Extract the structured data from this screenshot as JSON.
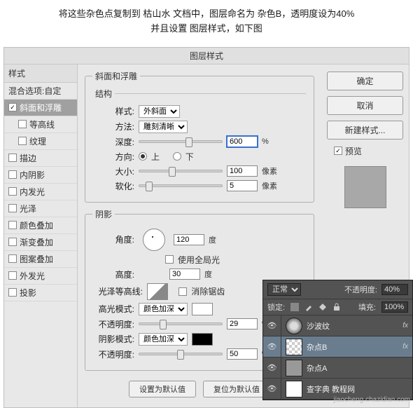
{
  "instruction": {
    "line1": "将这些杂色点复制到 枯山水 文档中，图层命名为 杂色B，透明度设为40%",
    "line2": "并且设置 图层样式，如下图"
  },
  "dialog": {
    "title": "图层样式",
    "styles_header": "样式",
    "blend_opts": "混合选项:自定",
    "style_items": [
      {
        "label": "斜面和浮雕",
        "checked": true,
        "selected": true
      },
      {
        "label": "等高线",
        "checked": false,
        "indent": true
      },
      {
        "label": "纹理",
        "checked": false,
        "indent": true
      },
      {
        "label": "描边",
        "checked": false
      },
      {
        "label": "内阴影",
        "checked": false
      },
      {
        "label": "内发光",
        "checked": false
      },
      {
        "label": "光泽",
        "checked": false
      },
      {
        "label": "颜色叠加",
        "checked": false
      },
      {
        "label": "渐变叠加",
        "checked": false
      },
      {
        "label": "图案叠加",
        "checked": false
      },
      {
        "label": "外发光",
        "checked": false
      },
      {
        "label": "投影",
        "checked": false
      }
    ],
    "bevel": {
      "group": "斜面和浮雕",
      "structure": "结构",
      "style_lab": "样式:",
      "style_val": "外斜面",
      "tech_lab": "方法:",
      "tech_val": "雕刻清晰",
      "depth_lab": "深度:",
      "depth_val": "600",
      "depth_unit": "%",
      "dir_lab": "方向:",
      "dir_up": "上",
      "dir_down": "下",
      "size_lab": "大小:",
      "size_val": "100",
      "size_unit": "像素",
      "soften_lab": "软化:",
      "soften_val": "5",
      "soften_unit": "像素"
    },
    "shade": {
      "group": "阴影",
      "angle_lab": "角度:",
      "angle_val": "120",
      "angle_unit": "度",
      "global_lab": "使用全局光",
      "alt_lab": "高度:",
      "alt_val": "30",
      "alt_unit": "度",
      "gloss_lab": "光泽等高线:",
      "antialias": "消除锯齿",
      "hl_mode_lab": "高光模式:",
      "hl_mode_val": "颜色加深",
      "hl_op_lab": "不透明度:",
      "hl_op_val": "29",
      "hl_op_unit": "%",
      "sh_mode_lab": "阴影模式:",
      "sh_mode_val": "颜色加深",
      "sh_op_lab": "不透明度:",
      "sh_op_val": "50",
      "sh_op_unit": "%"
    },
    "set_default": "设置为默认值",
    "reset_default": "复位为默认值",
    "ok": "确定",
    "cancel": "取消",
    "new_style": "新建样式...",
    "preview": "预览"
  },
  "layers": {
    "blend": "正常",
    "opacity_lab": "不透明度:",
    "opacity_val": "40%",
    "lock_lab": "锁定:",
    "fill_lab": "填充:",
    "fill_val": "100%",
    "rows": [
      {
        "name": "沙波纹",
        "fx": "fx"
      },
      {
        "name": "杂点B",
        "fx": "fx",
        "sel": true
      },
      {
        "name": "杂点A"
      },
      {
        "name": "查字典 教程网"
      }
    ]
  },
  "watermark": "jiaocheng.chazidian.com"
}
